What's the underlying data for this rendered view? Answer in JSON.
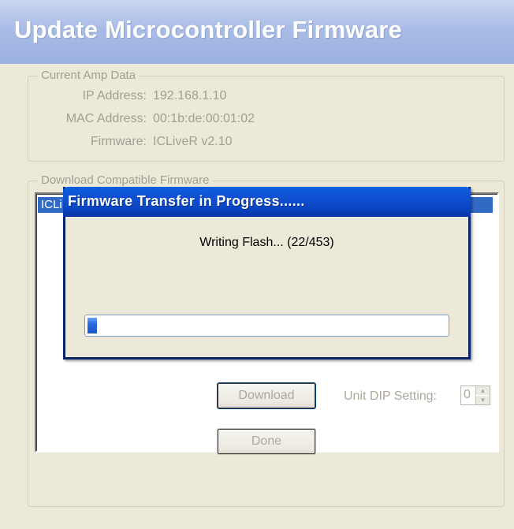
{
  "window": {
    "title": "Update Microcontroller Firmware"
  },
  "current_amp": {
    "legend": "Current Amp Data",
    "rows": [
      {
        "label": "IP Address:",
        "value": "192.168.1.10"
      },
      {
        "label": "MAC Address:",
        "value": "00:1b:de:00:01:02"
      },
      {
        "label": "Firmware:",
        "value": "ICLiveR v2.10"
      }
    ]
  },
  "download_section": {
    "legend": "Download Compatible Firmware",
    "list": {
      "selected_item_visible": "ICLi"
    },
    "download_label": "Download",
    "dip_label": "Unit DIP Setting:",
    "dip_value": "0"
  },
  "done_label": "Done",
  "transfer_dialog": {
    "title": "Firmware Transfer in Progress......",
    "status": "Writing Flash... (22/453)",
    "progress": {
      "current": 22,
      "total": 453
    }
  },
  "colors": {
    "selection": "#316ac5",
    "dialog_title": "#0a46c4",
    "progress_chunk": "#2768e0"
  }
}
